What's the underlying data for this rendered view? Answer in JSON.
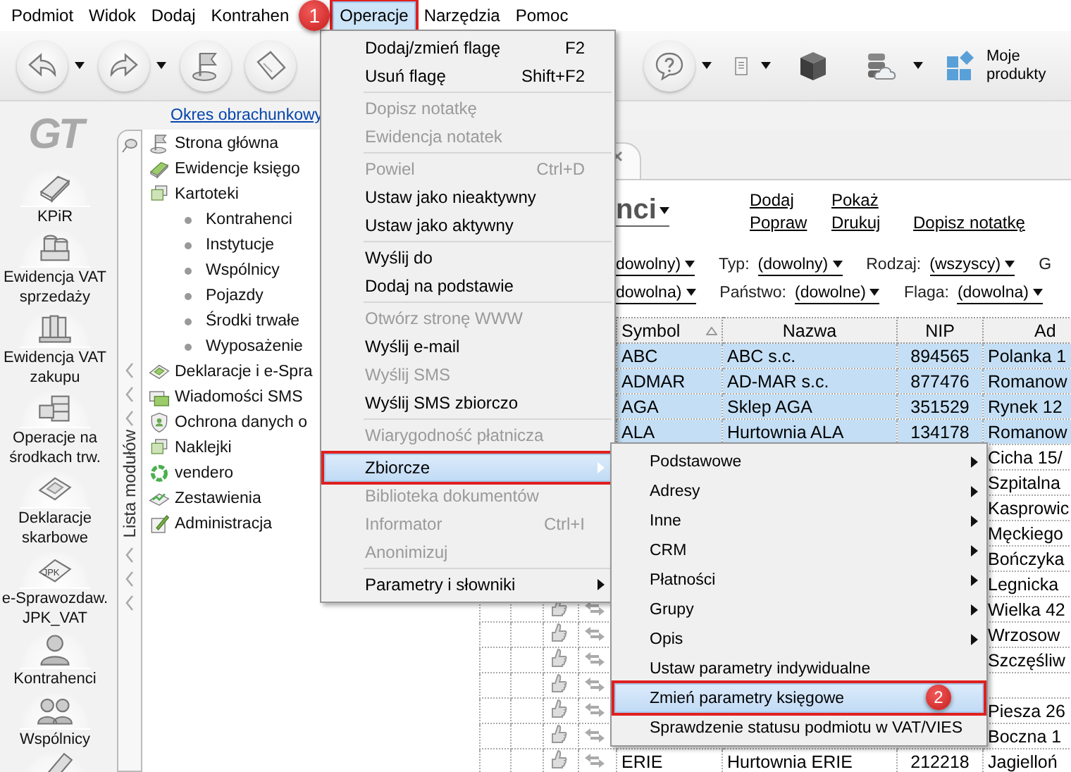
{
  "menubar": [
    {
      "label": "Podmiot",
      "selected": false,
      "highlighted": false
    },
    {
      "label": "Widok",
      "selected": false,
      "highlighted": false
    },
    {
      "label": "Dodaj",
      "selected": false,
      "highlighted": false
    },
    {
      "label": "Kontrahen",
      "selected": false,
      "highlighted": false
    },
    {
      "label": "Operacje",
      "selected": true,
      "highlighted": true,
      "badge": "1"
    },
    {
      "label": "Narzędzia",
      "selected": false,
      "highlighted": false
    },
    {
      "label": "Pomoc",
      "selected": false,
      "highlighted": false
    }
  ],
  "toolbar": {
    "left": [
      {
        "kind": "back",
        "dropdown": true
      },
      {
        "kind": "forward",
        "dropdown": true
      },
      {
        "kind": "flag",
        "dropdown": false
      },
      {
        "kind": "note",
        "dropdown": false
      }
    ],
    "right": [
      {
        "kind": "help",
        "dropdown": true
      },
      {
        "kind": "document",
        "dropdown": true
      },
      {
        "kind": "cube",
        "dropdown": false
      },
      {
        "kind": "cloud",
        "dropdown": true
      },
      {
        "kind": "products",
        "dropdown": false,
        "label": "Moje produkty"
      }
    ]
  },
  "logo": "GT",
  "left_nav": [
    {
      "kind": "book",
      "label": "KPiR"
    },
    {
      "kind": "coins",
      "label": "Ewidencja VAT sprzedaży"
    },
    {
      "kind": "binders",
      "label": "Ewidencja VAT zakupu"
    },
    {
      "kind": "cabinet",
      "label": "Operacje na środkach trw."
    },
    {
      "kind": "forms",
      "label": "Deklaracje skarbowe"
    },
    {
      "kind": "jpk",
      "label": "e-Sprawozdaw. JPK_VAT",
      "icon_text": "JPK"
    },
    {
      "kind": "person",
      "label": "Kontrahenci"
    },
    {
      "kind": "people",
      "label": "Wspólnicy"
    },
    {
      "kind": "pen"
    }
  ],
  "period_link": "Okres obrachunkowy",
  "modules": {
    "tab_label": "Lista modułów",
    "tree": [
      {
        "kind": "flag",
        "label": "Strona główna"
      },
      {
        "kind": "book",
        "label": "Ewidencje księgo"
      },
      {
        "kind": "folders",
        "label": "Kartoteki",
        "children": [
          {
            "label": "Kontrahenci"
          },
          {
            "label": "Instytucje"
          },
          {
            "label": "Wspólnicy"
          },
          {
            "label": "Pojazdy"
          },
          {
            "label": "Środki trwałe"
          },
          {
            "label": "Wyposażenie"
          }
        ]
      },
      {
        "kind": "forms",
        "label": "Deklaracje i e-Spra"
      },
      {
        "kind": "sms",
        "label": "Wiadomości SMS"
      },
      {
        "kind": "shield",
        "label": "Ochrona danych o"
      },
      {
        "kind": "folders",
        "label": "Naklejki"
      },
      {
        "kind": "ring",
        "label": "vendero"
      },
      {
        "kind": "chart",
        "label": "Zestawienia"
      },
      {
        "kind": "edit",
        "label": "Administracja"
      }
    ]
  },
  "main": {
    "title": "nci",
    "links": [
      [
        "Dodaj",
        "Pokaż"
      ],
      [
        "Popraw",
        "Drukuj",
        "Dopisz notatkę"
      ]
    ],
    "filters": [
      [
        {
          "value": "dowolny)"
        },
        {
          "label": "Typ:",
          "value": "(dowolny)"
        },
        {
          "label": "Rodzaj:",
          "value": "(wszyscy)"
        },
        {
          "label": "G"
        }
      ],
      [
        {
          "value": "dowolna)"
        },
        {
          "label": "Państwo:",
          "value": "(dowolne)"
        },
        {
          "label": "Flaga:",
          "value": "(dowolna)"
        }
      ]
    ],
    "table": {
      "columns": [
        {
          "label": "Symbol",
          "sorted": true
        },
        {
          "label": "Nazwa",
          "sorted": false
        },
        {
          "label": "NIP",
          "sorted": false
        },
        {
          "label": "Ad",
          "sorted": false
        }
      ],
      "rows": [
        {
          "symbol": "ABC",
          "name": "ABC s.c.",
          "nip": "894565",
          "address": "Polanka 1",
          "selected": true
        },
        {
          "symbol": "ADMAR",
          "name": "AD-MAR s.c.",
          "nip": "877476",
          "address": "Romanow",
          "selected": true
        },
        {
          "symbol": "AGA",
          "name": "Sklep AGA",
          "nip": "351529",
          "address": "Rynek 12",
          "selected": true
        },
        {
          "symbol": "ALA",
          "name": "Hurtownia ALA",
          "nip": "134178",
          "address": "Romanow",
          "selected": true
        },
        {
          "address": "Cicha 15/",
          "selected": false
        },
        {
          "address": "Szpitalna",
          "selected": false
        },
        {
          "address": "Kasprowic",
          "selected": false
        },
        {
          "address": "Męckiego",
          "selected": false
        },
        {
          "address": "Bończyka",
          "selected": false
        },
        {
          "address": "Legnicka",
          "selected": false
        },
        {
          "address": "Wielka 42",
          "selected": false
        },
        {
          "address": "Wrzosow",
          "selected": false
        },
        {
          "address": "Szczęśliw",
          "selected": false
        },
        {
          "selected": false
        },
        {
          "address": "Piesza 26",
          "selected": false
        },
        {
          "address": "Boczna 1",
          "selected": false
        },
        {
          "symbol": "ERIE",
          "name": "Hurtownia ERIE",
          "nip": "212218",
          "address": "Jagielloń",
          "selected": false
        }
      ]
    }
  },
  "operations_menu": {
    "groups": [
      [
        {
          "label": "Dodaj/zmień flagę",
          "shortcut": "F2",
          "disabled": false,
          "submenu": false,
          "selected": false,
          "highlighted": false
        },
        {
          "label": "Usuń flagę",
          "shortcut": "Shift+F2",
          "disabled": false,
          "submenu": false,
          "selected": false,
          "highlighted": false
        }
      ],
      [
        {
          "label": "Dopisz notatkę",
          "disabled": true,
          "submenu": false,
          "selected": false,
          "highlighted": false
        },
        {
          "label": "Ewidencja notatek",
          "disabled": true,
          "submenu": false,
          "selected": false,
          "highlighted": false
        }
      ],
      [
        {
          "label": "Powiel",
          "shortcut": "Ctrl+D",
          "disabled": true,
          "submenu": false,
          "selected": false,
          "highlighted": false
        },
        {
          "label": "Ustaw jako nieaktywny",
          "disabled": false,
          "submenu": false,
          "selected": false,
          "highlighted": false
        },
        {
          "label": "Ustaw jako aktywny",
          "disabled": false,
          "submenu": false,
          "selected": false,
          "highlighted": false
        }
      ],
      [
        {
          "label": "Wyślij do",
          "disabled": false,
          "submenu": false,
          "selected": false,
          "highlighted": false
        },
        {
          "label": "Dodaj na podstawie",
          "disabled": false,
          "submenu": false,
          "selected": false,
          "highlighted": false
        }
      ],
      [
        {
          "label": "Otwórz stronę WWW",
          "disabled": true,
          "submenu": false,
          "selected": false,
          "highlighted": false
        },
        {
          "label": "Wyślij e-mail",
          "disabled": false,
          "submenu": false,
          "selected": false,
          "highlighted": false
        },
        {
          "label": "Wyślij SMS",
          "disabled": true,
          "submenu": false,
          "selected": false,
          "highlighted": false
        },
        {
          "label": "Wyślij SMS zbiorczo",
          "disabled": false,
          "submenu": false,
          "selected": false,
          "highlighted": false
        }
      ],
      [
        {
          "label": "Wiarygodność płatnicza",
          "disabled": true,
          "submenu": false,
          "selected": false,
          "highlighted": false
        }
      ],
      [
        {
          "label": "Zbiorcze",
          "disabled": false,
          "submenu": true,
          "selected": true,
          "highlighted": true
        },
        {
          "label": "Biblioteka dokumentów",
          "disabled": true,
          "submenu": false,
          "selected": false,
          "highlighted": false
        },
        {
          "label": "Informator",
          "shortcut": "Ctrl+I",
          "disabled": true,
          "submenu": false,
          "selected": false,
          "highlighted": false
        },
        {
          "label": "Anonimizuj",
          "disabled": true,
          "submenu": false,
          "selected": false,
          "highlighted": false
        }
      ],
      [
        {
          "label": "Parametry i słowniki",
          "disabled": false,
          "submenu": true,
          "selected": false,
          "highlighted": false
        }
      ]
    ]
  },
  "collective_submenu": {
    "items": [
      {
        "label": "Podstawowe",
        "submenu": true,
        "selected": false,
        "highlighted": false
      },
      {
        "label": "Adresy",
        "submenu": true,
        "selected": false,
        "highlighted": false
      },
      {
        "label": "Inne",
        "submenu": true,
        "selected": false,
        "highlighted": false
      },
      {
        "label": "CRM",
        "submenu": true,
        "selected": false,
        "highlighted": false
      },
      {
        "label": "Płatności",
        "submenu": true,
        "selected": false,
        "highlighted": false
      },
      {
        "label": "Grupy",
        "submenu": true,
        "selected": false,
        "highlighted": false
      },
      {
        "label": "Opis",
        "submenu": true,
        "selected": false,
        "highlighted": false
      },
      {
        "label": "Ustaw parametry indywidualne",
        "submenu": false,
        "selected": false,
        "highlighted": false
      },
      {
        "label": "Zmień parametry księgowe",
        "submenu": false,
        "selected": true,
        "highlighted": true,
        "badge": "2"
      },
      {
        "label": "Sprawdzenie statusu podmiotu w VAT/VIES",
        "submenu": false,
        "selected": false,
        "highlighted": false
      }
    ]
  }
}
